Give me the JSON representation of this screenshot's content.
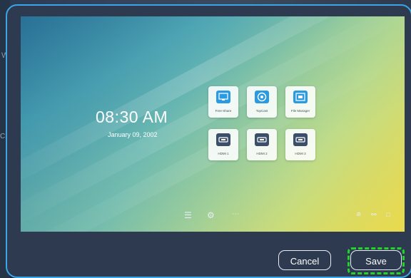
{
  "background": {
    "left_char_1": "W",
    "left_text": "Cha"
  },
  "preview": {
    "time": "08:30 AM",
    "date": "January 09, 2002",
    "apps": [
      {
        "label": "Free-Share",
        "icon": "screen-share-icon"
      },
      {
        "label": "TopCast",
        "icon": "cast-icon"
      },
      {
        "label": "File Manager",
        "icon": "file-manager-icon"
      },
      {
        "label": "HDMI 1",
        "icon": "hdmi-icon"
      },
      {
        "label": "HDMI 2",
        "icon": "hdmi-icon"
      },
      {
        "label": "HDMI 3",
        "icon": "hdmi-icon"
      }
    ],
    "dock_icons": [
      "menu-icon",
      "settings-icon",
      "apps-grid-icon"
    ],
    "tray_icons": [
      "wifi-icon",
      "network-icon",
      "usb-icon"
    ]
  },
  "buttons": {
    "cancel": "Cancel",
    "save": "Save"
  },
  "colors": {
    "dialog_bg": "#2d3a4f",
    "dialog_border": "#3aa6e8",
    "highlight": "#22d32a"
  }
}
